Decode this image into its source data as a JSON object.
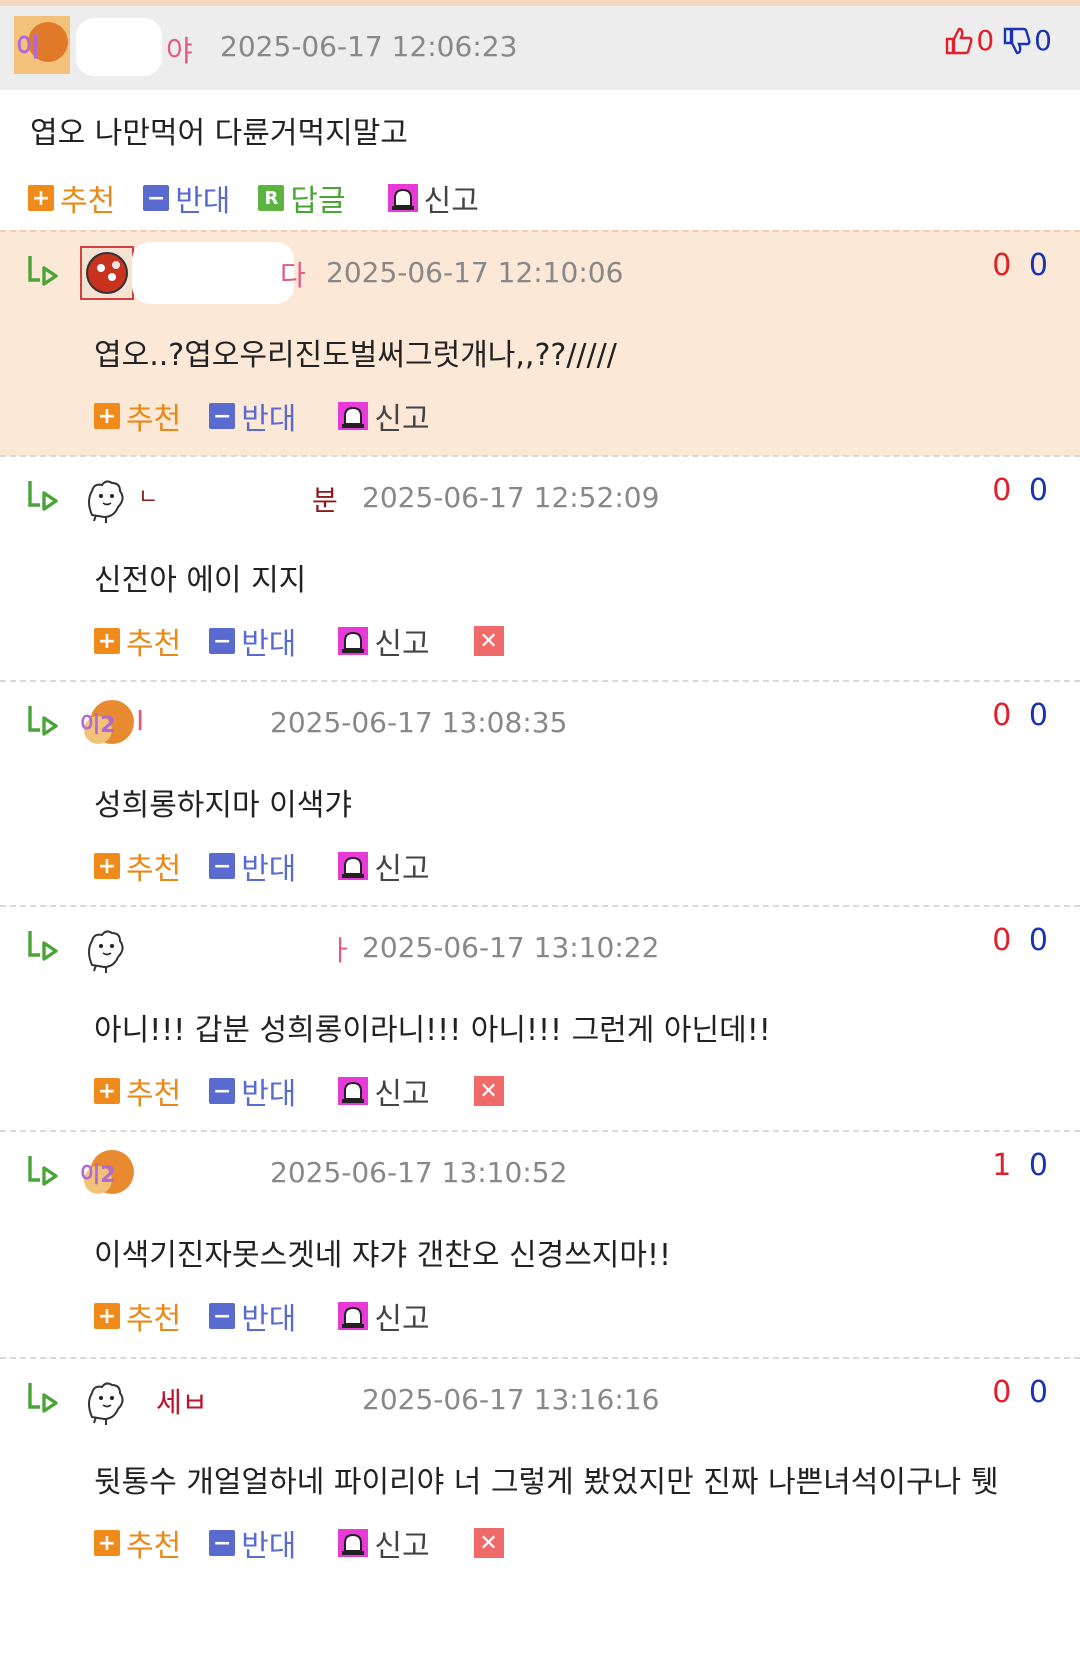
{
  "root": {
    "nickname_tail": "야",
    "date": "2025-06-17 12:06:23",
    "likes": "0",
    "dislikes": "0",
    "body": "엽오 나만먹어 다륜거먹지말고",
    "actions": {
      "recommend": "추천",
      "oppose": "반대",
      "reply": "답글",
      "report": "신고"
    },
    "reply_badge": "R"
  },
  "replies": [
    {
      "nickname_tail": "다",
      "date": "2025-06-17 12:10:06",
      "up": "0",
      "down": "0",
      "body": "엽오..?엽오우리진도벌써그럿개나,,??/////",
      "actions": {
        "recommend": "추천",
        "oppose": "반대",
        "report": "신고"
      }
    },
    {
      "nickname_head": "ㄴ",
      "nickname_tail": "분",
      "date": "2025-06-17 12:52:09",
      "up": "0",
      "down": "0",
      "body": "신전아 에이 지지",
      "actions": {
        "recommend": "추천",
        "oppose": "반대",
        "report": "신고"
      }
    },
    {
      "nickname_tail": "I",
      "date": "2025-06-17 13:08:35",
      "up": "0",
      "down": "0",
      "body": "성희롱하지마 이색갸",
      "actions": {
        "recommend": "추천",
        "oppose": "반대",
        "report": "신고"
      }
    },
    {
      "nickname_tail": "ㅏ",
      "date": "2025-06-17 13:10:22",
      "up": "0",
      "down": "0",
      "body": "아니!!! 갑분 성희롱이라니!!! 아니!!! 그런게 아닌데!!",
      "actions": {
        "recommend": "추천",
        "oppose": "반대",
        "report": "신고"
      }
    },
    {
      "nickname_tail": "",
      "date": "2025-06-17 13:10:52",
      "up": "1",
      "down": "0",
      "body": "이색기진자못스겟네 쟈갸 갠찬오 신경쓰지마!!",
      "actions": {
        "recommend": "추천",
        "oppose": "반대",
        "report": "신고"
      }
    },
    {
      "nickname_tail": "세ㅂ",
      "date": "2025-06-17 13:16:16",
      "up": "0",
      "down": "0",
      "body": "뒷통수 개얼얼하네 파이리야 너 그렇게 봤었지만 진짜 나쁜녀석이구나 퉷",
      "actions": {
        "recommend": "추천",
        "oppose": "반대",
        "report": "신고"
      }
    }
  ],
  "colors": {
    "recommend": "#e8891a",
    "oppose": "#5a6bd0",
    "reply": "#4aa438",
    "up": "#e0202a",
    "down": "#1a34b0",
    "highlight": "#fbe8d6"
  }
}
